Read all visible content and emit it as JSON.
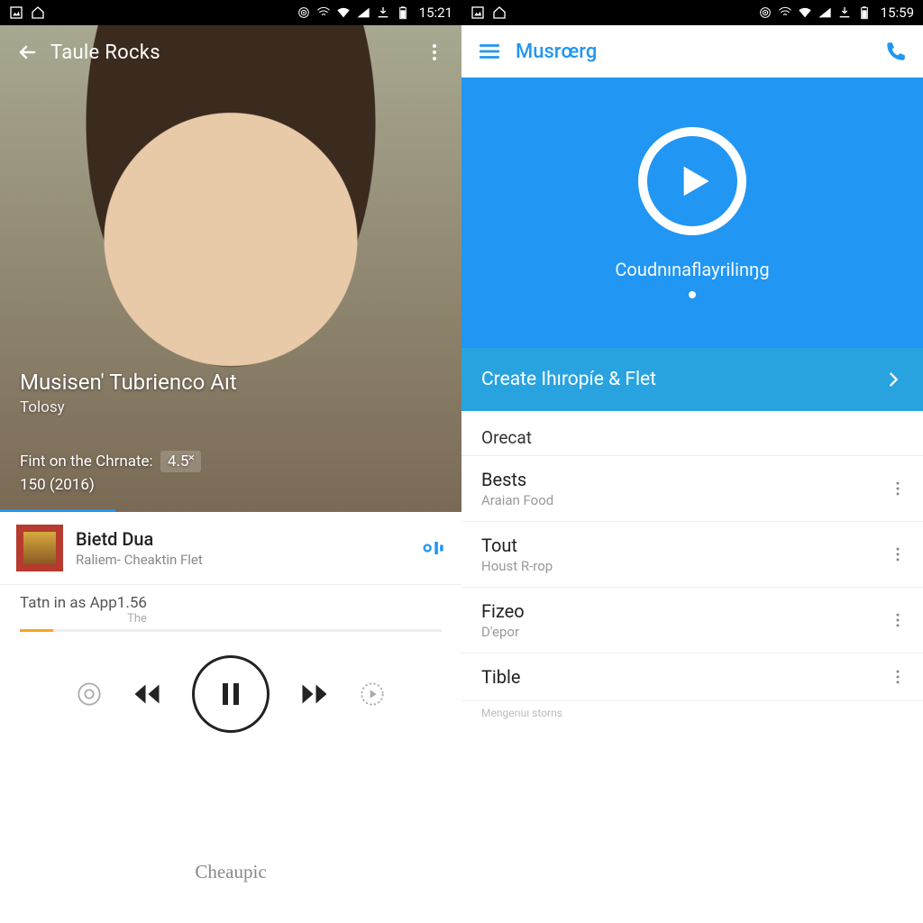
{
  "left": {
    "status": {
      "time": "15:21"
    },
    "appbar": {
      "title": "Taule Rocks"
    },
    "hero": {
      "title": "Musisen' Tubrienco Aıt",
      "subtitle": "Tolosy",
      "meta_label": "Fint on the Chrnate:",
      "meta_rating": "4.5˟",
      "meta_line2": "150 (2016)"
    },
    "track": {
      "title": "Bietd Dua",
      "artist": "Raliem- Cheaktin Flet"
    },
    "mini": {
      "title": "Tatn in as App",
      "value": "1.56",
      "sub": "The"
    },
    "brand": "Cheaupic"
  },
  "right": {
    "status": {
      "time": "15:59"
    },
    "appbar": {
      "title": "Musrœrg"
    },
    "hero_text": "Coudnınaflayrilinŋg",
    "create_label": "Create I‌hıropíe & Flet",
    "section": "Orecat",
    "items": [
      {
        "title": "Bests",
        "sub": "Araian Food"
      },
      {
        "title": "Tout",
        "sub": "Houst R-rop"
      },
      {
        "title": "Fizeo",
        "sub": "D'epor"
      },
      {
        "title": "Tible",
        "sub": ""
      }
    ],
    "footer": "Mengerıuı storns"
  }
}
